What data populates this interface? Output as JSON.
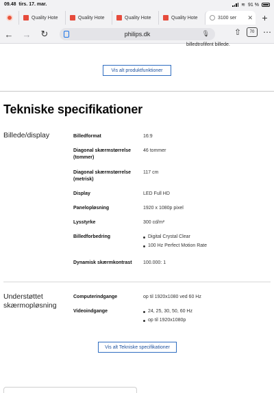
{
  "status": {
    "time": "09.48",
    "date": "tirs. 17. mar.",
    "battery": "91 %"
  },
  "tabs": [
    {
      "label": "Quality Hote"
    },
    {
      "label": "Quality Hote"
    },
    {
      "label": "Quality Hote"
    },
    {
      "label": "Quality Hote"
    },
    {
      "label": "3100 ser"
    }
  ],
  "address": {
    "host": "philips.dk",
    "tab_count": "70"
  },
  "icons": {
    "back": "arrow-left-icon",
    "forward": "arrow-right-icon",
    "reload": "reload-icon",
    "share": "share-icon",
    "menu": "more-icon",
    "add_tab": "plus-icon",
    "mic": "microphone-icon"
  },
  "caption": "billedtrofifent billede.",
  "buttons": {
    "features": "Vis alt produktfunktioner",
    "specs": "Vis alt Tekniske specifikationer"
  },
  "heading": "Tekniske specifikationer",
  "sections": {
    "display": {
      "title": "Billede/display",
      "rows": [
        {
          "label": "Billedformat",
          "value": "16:9"
        },
        {
          "label": "Diagonal skærmstørrelse (tommer)",
          "value": "46 tommer"
        },
        {
          "label": "Diagonal skærmstørrelse (metrisk)",
          "value": "117 cm"
        },
        {
          "label": "Display",
          "value": "LED Full HD"
        },
        {
          "label": "Panelopløsning",
          "value": "1920 x 1080p pixel"
        },
        {
          "label": "Lysstyrke",
          "value": "300 cd/m²"
        },
        {
          "label": "Billedforbedring",
          "values": [
            "Digital Crystal Clear",
            "100 Hz Perfect Motion Rate"
          ]
        },
        {
          "label": "Dynamisk skærmkontrast",
          "value": "100.000: 1"
        }
      ]
    },
    "resolution": {
      "title": "Understøttet skærmopløsning",
      "rows": [
        {
          "label": "Computerindgange",
          "value": "op til 1920x1080 ved 60 Hz"
        },
        {
          "label": "Videoindgange",
          "values": [
            "24, 25, 30, 50, 60 Hz",
            "op til 1920x1080p"
          ]
        }
      ]
    }
  }
}
